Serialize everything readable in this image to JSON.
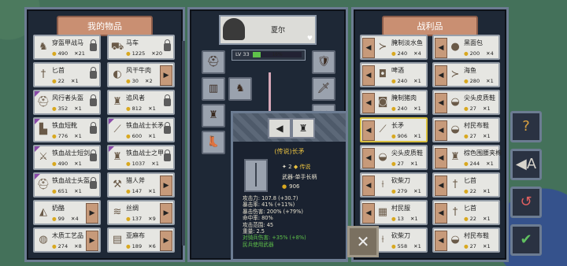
{
  "left_panel": {
    "title": "我的物品",
    "items": [
      {
        "name": "穿盔甲战马",
        "price": "490",
        "qty": "21",
        "icon": "horse-icon",
        "control": "lock"
      },
      {
        "name": "马车",
        "price": "1225",
        "qty": "20",
        "icon": "cart-icon",
        "control": "lock"
      },
      {
        "name": "匕首",
        "price": "22",
        "qty": "1",
        "icon": "dagger-icon",
        "control": "lock"
      },
      {
        "name": "风干牛肉",
        "price": "30",
        "qty": "2",
        "icon": "meat-icon",
        "control": "arrow"
      },
      {
        "name": "风行者头盔",
        "price": "352",
        "qty": "1",
        "icon": "helmet-icon",
        "control": "lock"
      },
      {
        "name": "追风者",
        "price": "812",
        "qty": "1",
        "icon": "armor-icon",
        "control": "lock"
      },
      {
        "name": "铁血短靴",
        "price": "776",
        "qty": "1",
        "icon": "boots-icon",
        "control": "lock"
      },
      {
        "name": "铁血战士长矛",
        "price": "600",
        "qty": "1",
        "icon": "spear-icon",
        "control": "lock"
      },
      {
        "name": "铁血战士短剑",
        "price": "490",
        "qty": "1",
        "icon": "sword-icon",
        "control": "lock"
      },
      {
        "name": "铁血战士之甲",
        "price": "1037",
        "qty": "1",
        "icon": "armor-icon",
        "control": "lock"
      },
      {
        "name": "铁血战士头盔",
        "price": "651",
        "qty": "1",
        "icon": "helmet-icon",
        "control": "lock"
      },
      {
        "name": "猎人斧",
        "price": "147",
        "qty": "1",
        "icon": "axe-icon",
        "control": "arrow"
      },
      {
        "name": "奶酪",
        "price": "99",
        "qty": "4",
        "icon": "cheese-icon",
        "control": "arrow"
      },
      {
        "name": "丝绸",
        "price": "137",
        "qty": "9",
        "icon": "silk-icon",
        "control": "arrow"
      },
      {
        "name": "木质工艺品",
        "price": "274",
        "qty": "8",
        "icon": "crafts-icon",
        "control": "arrow"
      },
      {
        "name": "亚麻布",
        "price": "189",
        "qty": "6",
        "icon": "linen-icon",
        "control": "arrow"
      }
    ]
  },
  "character": {
    "name": "夏尔",
    "level": "LV 33",
    "xp_percent": "16%",
    "xp_fraction": 0.16
  },
  "item_popup": {
    "title": "(传说)长矛",
    "tier_count": "2",
    "tier_label": "传说",
    "type": "武器-单手长柄",
    "price": "906",
    "stats": [
      {
        "label": "攻击力:",
        "value": "107.8 (+30.7)",
        "green": false
      },
      {
        "label": "暴击率:",
        "value": "41% (+11%)",
        "green": false
      },
      {
        "label": "暴击伤害:",
        "value": "200% (+79%)",
        "green": false
      },
      {
        "label": "命中率:",
        "value": "80%",
        "green": false
      },
      {
        "label": "攻击范围:",
        "value": "45",
        "green": false
      },
      {
        "label": "重量:",
        "value": "2.5",
        "green": false
      },
      {
        "label": "对骑兵伤害:",
        "value": "+35% (+8%)",
        "green": true
      },
      {
        "label": "民兵使用武器",
        "value": "",
        "green": true
      }
    ]
  },
  "right_panel": {
    "title": "战利品",
    "items": [
      {
        "name": "腌制淡水鱼",
        "price": "240",
        "qty": "4",
        "icon": "fish-icon"
      },
      {
        "name": "黑面包",
        "price": "200",
        "qty": "4",
        "icon": "bread-icon"
      },
      {
        "name": "啤酒",
        "price": "240",
        "qty": "1",
        "icon": "beer-icon"
      },
      {
        "name": "海鱼",
        "price": "280",
        "qty": "1",
        "icon": "fish-icon"
      },
      {
        "name": "腌制猪肉",
        "price": "240",
        "qty": "1",
        "icon": "pork-icon"
      },
      {
        "name": "尖头皮质鞋",
        "price": "27",
        "qty": "1",
        "icon": "shoes-icon"
      },
      {
        "name": "长矛",
        "price": "906",
        "qty": "1",
        "icon": "spear-icon",
        "selected": true
      },
      {
        "name": "村民布鞋",
        "price": "27",
        "qty": "1",
        "icon": "shoes-icon"
      },
      {
        "name": "尖头皮质鞋",
        "price": "27",
        "qty": "1",
        "icon": "shoes-icon"
      },
      {
        "name": "棕色围腰夹棉",
        "price": "244",
        "qty": "1",
        "icon": "armor-icon"
      },
      {
        "name": "砍柴刀",
        "price": "279",
        "qty": "1",
        "icon": "cleaver-icon"
      },
      {
        "name": "匕首",
        "price": "22",
        "qty": "1",
        "icon": "dagger-icon"
      },
      {
        "name": "村民服",
        "price": "13",
        "qty": "1",
        "icon": "tunic-icon"
      },
      {
        "name": "匕首",
        "price": "22",
        "qty": "1",
        "icon": "dagger-icon"
      },
      {
        "name": "砍柴刀",
        "price": "558",
        "qty": "1",
        "icon": "cleaver-icon"
      },
      {
        "name": "村民布鞋",
        "price": "27",
        "qty": "1",
        "icon": "shoes-icon"
      }
    ]
  },
  "side_buttons": [
    {
      "icon": "question-icon",
      "glyph": "?"
    },
    {
      "icon": "auto-loot-icon",
      "glyph": "◀A"
    },
    {
      "icon": "reset-icon",
      "glyph": "↺"
    },
    {
      "icon": "confirm-icon",
      "glyph": "✔"
    }
  ],
  "colors": {
    "accent_title": "#c98f72",
    "selected": "#d8c040",
    "legend": "#e8c040",
    "positive": "#5fc24a"
  }
}
